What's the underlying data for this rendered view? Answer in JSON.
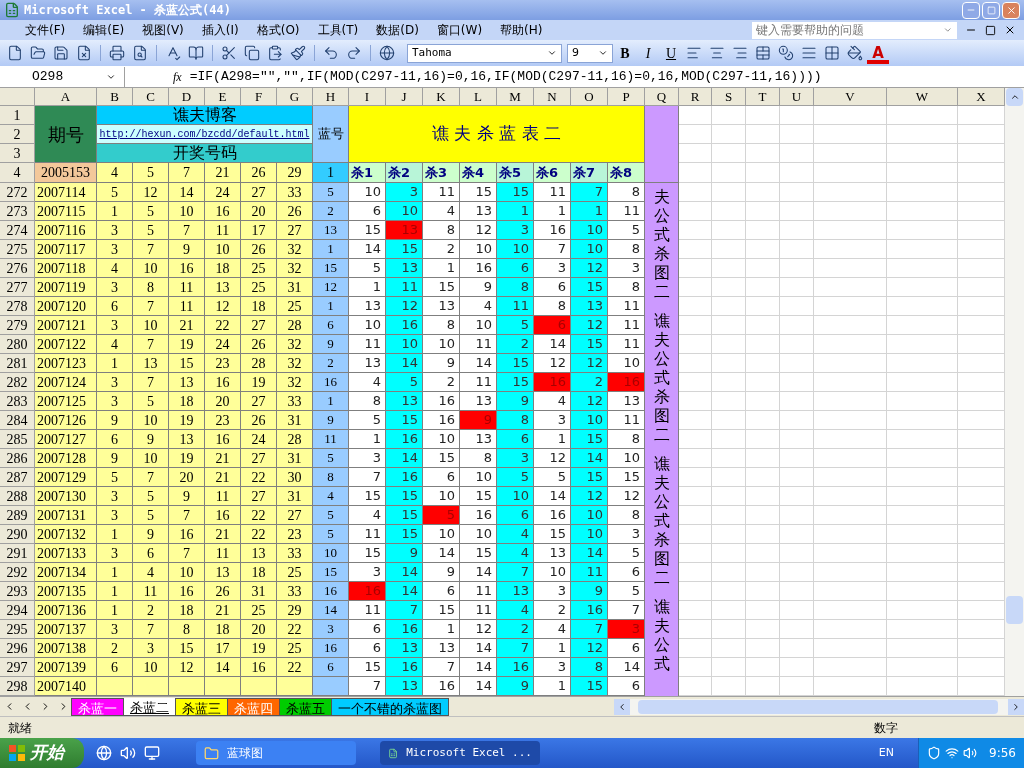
{
  "window": {
    "title": "Microsoft Excel - 杀蓝公式(44)"
  },
  "menu": [
    "文件(F)",
    "编辑(E)",
    "视图(V)",
    "插入(I)",
    "格式(O)",
    "工具(T)",
    "数据(D)",
    "窗口(W)",
    "帮助(H)"
  ],
  "help_box": {
    "placeholder": "键入需要帮助的问题"
  },
  "toolbar": {
    "font": "Tahoma",
    "size": "9",
    "format_buttons": [
      "B",
      "I",
      "U"
    ],
    "font_color_letter": "A"
  },
  "formula_bar": {
    "name_box": "O298",
    "fx": "fx",
    "formula": "=IF(A298=\"\",\"\",IF(MOD(C297-11,16)=0,16,IF(MOD(C297-11,16)=0,16,MOD(C297-11,16))))"
  },
  "columns": [
    "A",
    "B",
    "C",
    "D",
    "E",
    "F",
    "G",
    "H",
    "I",
    "J",
    "K",
    "L",
    "M",
    "N",
    "O",
    "P",
    "Q",
    "R",
    "S",
    "T",
    "U",
    "V",
    "W",
    "X"
  ],
  "header": {
    "row_numbers": [
      "1",
      "2",
      "3"
    ],
    "period_label": "期号",
    "blog_title": "谯夫博客",
    "link": "http://hexun.com/bzcdd/default.html",
    "draw_label": "开奖号码",
    "blue_label": "蓝号",
    "table_title": "谯 夫 杀 蓝 表 二",
    "side_texts": [
      "夫公式杀图二",
      "谯夫公式杀图二",
      "谯夫公式杀图二",
      "谯夫公式"
    ]
  },
  "first_row": {
    "row": "4",
    "period": "2005153",
    "numbers": [
      "4",
      "5",
      "7",
      "21",
      "26",
      "29"
    ],
    "blue": "1"
  },
  "kill_headers": [
    {
      "label": "杀1",
      "highlight": false
    },
    {
      "label": "杀2",
      "highlight": true
    },
    {
      "label": "杀3",
      "highlight": false
    },
    {
      "label": "杀4",
      "highlight": false
    },
    {
      "label": "杀5",
      "highlight": true
    },
    {
      "label": "杀6",
      "highlight": false
    },
    {
      "label": "杀7",
      "highlight": true
    },
    {
      "label": "杀8",
      "highlight": false
    }
  ],
  "rows": [
    {
      "row": "272",
      "period": "2007114",
      "numbers": [
        "5",
        "12",
        "14",
        "24",
        "27",
        "33"
      ],
      "blue": "5",
      "kills": [
        {
          "v": "10",
          "hit": false
        },
        {
          "v": "3",
          "hit": false
        },
        {
          "v": "11",
          "hit": false
        },
        {
          "v": "15",
          "hit": false
        },
        {
          "v": "15",
          "hit": false
        },
        {
          "v": "11",
          "hit": false
        },
        {
          "v": "7",
          "hit": false
        },
        {
          "v": "8",
          "hit": false
        }
      ]
    },
    {
      "row": "273",
      "period": "2007115",
      "numbers": [
        "1",
        "5",
        "10",
        "16",
        "20",
        "26"
      ],
      "blue": "2",
      "kills": [
        {
          "v": "6",
          "hit": false
        },
        {
          "v": "10",
          "hit": false
        },
        {
          "v": "4",
          "hit": false
        },
        {
          "v": "13",
          "hit": false
        },
        {
          "v": "1",
          "hit": false
        },
        {
          "v": "1",
          "hit": false
        },
        {
          "v": "1",
          "hit": false
        },
        {
          "v": "11",
          "hit": false
        }
      ]
    },
    {
      "row": "274",
      "period": "2007116",
      "numbers": [
        "3",
        "5",
        "7",
        "11",
        "17",
        "27"
      ],
      "blue": "13",
      "kills": [
        {
          "v": "15",
          "hit": false
        },
        {
          "v": "13",
          "hit": true
        },
        {
          "v": "8",
          "hit": false
        },
        {
          "v": "12",
          "hit": false
        },
        {
          "v": "3",
          "hit": false
        },
        {
          "v": "16",
          "hit": false
        },
        {
          "v": "10",
          "hit": false
        },
        {
          "v": "5",
          "hit": false
        }
      ]
    },
    {
      "row": "275",
      "period": "2007117",
      "numbers": [
        "3",
        "7",
        "9",
        "10",
        "26",
        "32"
      ],
      "blue": "1",
      "kills": [
        {
          "v": "14",
          "hit": false
        },
        {
          "v": "15",
          "hit": false
        },
        {
          "v": "2",
          "hit": false
        },
        {
          "v": "10",
          "hit": false
        },
        {
          "v": "10",
          "hit": false
        },
        {
          "v": "7",
          "hit": false
        },
        {
          "v": "10",
          "hit": false
        },
        {
          "v": "8",
          "hit": false
        }
      ]
    },
    {
      "row": "276",
      "period": "2007118",
      "numbers": [
        "4",
        "10",
        "16",
        "18",
        "25",
        "32"
      ],
      "blue": "15",
      "kills": [
        {
          "v": "5",
          "hit": false
        },
        {
          "v": "13",
          "hit": false
        },
        {
          "v": "1",
          "hit": false
        },
        {
          "v": "16",
          "hit": false
        },
        {
          "v": "6",
          "hit": false
        },
        {
          "v": "3",
          "hit": false
        },
        {
          "v": "12",
          "hit": false
        },
        {
          "v": "3",
          "hit": false
        }
      ]
    },
    {
      "row": "277",
      "period": "2007119",
      "numbers": [
        "3",
        "8",
        "11",
        "13",
        "25",
        "31"
      ],
      "blue": "12",
      "kills": [
        {
          "v": "1",
          "hit": false
        },
        {
          "v": "11",
          "hit": false
        },
        {
          "v": "15",
          "hit": false
        },
        {
          "v": "9",
          "hit": false
        },
        {
          "v": "8",
          "hit": false
        },
        {
          "v": "6",
          "hit": false
        },
        {
          "v": "15",
          "hit": false
        },
        {
          "v": "8",
          "hit": false
        }
      ]
    },
    {
      "row": "278",
      "period": "2007120",
      "numbers": [
        "6",
        "7",
        "11",
        "12",
        "18",
        "25"
      ],
      "blue": "1",
      "kills": [
        {
          "v": "13",
          "hit": false
        },
        {
          "v": "12",
          "hit": false
        },
        {
          "v": "13",
          "hit": false
        },
        {
          "v": "4",
          "hit": false
        },
        {
          "v": "11",
          "hit": false
        },
        {
          "v": "8",
          "hit": false
        },
        {
          "v": "13",
          "hit": false
        },
        {
          "v": "11",
          "hit": false
        }
      ]
    },
    {
      "row": "279",
      "period": "2007121",
      "numbers": [
        "3",
        "10",
        "21",
        "22",
        "27",
        "28"
      ],
      "blue": "6",
      "kills": [
        {
          "v": "10",
          "hit": false
        },
        {
          "v": "16",
          "hit": false
        },
        {
          "v": "8",
          "hit": false
        },
        {
          "v": "10",
          "hit": false
        },
        {
          "v": "5",
          "hit": false
        },
        {
          "v": "6",
          "hit": true
        },
        {
          "v": "12",
          "hit": false
        },
        {
          "v": "11",
          "hit": false
        }
      ]
    },
    {
      "row": "280",
      "period": "2007122",
      "numbers": [
        "4",
        "7",
        "19",
        "24",
        "26",
        "32"
      ],
      "blue": "9",
      "kills": [
        {
          "v": "11",
          "hit": false
        },
        {
          "v": "10",
          "hit": false
        },
        {
          "v": "10",
          "hit": false
        },
        {
          "v": "11",
          "hit": false
        },
        {
          "v": "2",
          "hit": false
        },
        {
          "v": "14",
          "hit": false
        },
        {
          "v": "15",
          "hit": false
        },
        {
          "v": "11",
          "hit": false
        }
      ]
    },
    {
      "row": "281",
      "period": "2007123",
      "numbers": [
        "1",
        "13",
        "15",
        "23",
        "28",
        "32"
      ],
      "blue": "2",
      "kills": [
        {
          "v": "13",
          "hit": false
        },
        {
          "v": "14",
          "hit": false
        },
        {
          "v": "9",
          "hit": false
        },
        {
          "v": "14",
          "hit": false
        },
        {
          "v": "15",
          "hit": false
        },
        {
          "v": "12",
          "hit": false
        },
        {
          "v": "12",
          "hit": false
        },
        {
          "v": "10",
          "hit": false
        }
      ]
    },
    {
      "row": "282",
      "period": "2007124",
      "numbers": [
        "3",
        "7",
        "13",
        "16",
        "19",
        "32"
      ],
      "blue": "16",
      "kills": [
        {
          "v": "4",
          "hit": false
        },
        {
          "v": "5",
          "hit": false
        },
        {
          "v": "2",
          "hit": false
        },
        {
          "v": "11",
          "hit": false
        },
        {
          "v": "15",
          "hit": false
        },
        {
          "v": "16",
          "hit": true
        },
        {
          "v": "2",
          "hit": false
        },
        {
          "v": "16",
          "hit": true
        }
      ]
    },
    {
      "row": "283",
      "period": "2007125",
      "numbers": [
        "3",
        "5",
        "18",
        "20",
        "27",
        "33"
      ],
      "blue": "1",
      "kills": [
        {
          "v": "8",
          "hit": false
        },
        {
          "v": "13",
          "hit": false
        },
        {
          "v": "16",
          "hit": false
        },
        {
          "v": "13",
          "hit": false
        },
        {
          "v": "9",
          "hit": false
        },
        {
          "v": "4",
          "hit": false
        },
        {
          "v": "12",
          "hit": false
        },
        {
          "v": "13",
          "hit": false
        }
      ]
    },
    {
      "row": "284",
      "period": "2007126",
      "numbers": [
        "9",
        "10",
        "19",
        "23",
        "26",
        "31"
      ],
      "blue": "9",
      "kills": [
        {
          "v": "5",
          "hit": false
        },
        {
          "v": "15",
          "hit": false
        },
        {
          "v": "16",
          "hit": false
        },
        {
          "v": "9",
          "hit": true
        },
        {
          "v": "8",
          "hit": false
        },
        {
          "v": "3",
          "hit": false
        },
        {
          "v": "10",
          "hit": false
        },
        {
          "v": "11",
          "hit": false
        }
      ]
    },
    {
      "row": "285",
      "period": "2007127",
      "numbers": [
        "6",
        "9",
        "13",
        "16",
        "24",
        "28"
      ],
      "blue": "11",
      "kills": [
        {
          "v": "1",
          "hit": false
        },
        {
          "v": "16",
          "hit": false
        },
        {
          "v": "10",
          "hit": false
        },
        {
          "v": "13",
          "hit": false
        },
        {
          "v": "6",
          "hit": false
        },
        {
          "v": "1",
          "hit": false
        },
        {
          "v": "15",
          "hit": false
        },
        {
          "v": "8",
          "hit": false
        }
      ]
    },
    {
      "row": "286",
      "period": "2007128",
      "numbers": [
        "9",
        "10",
        "19",
        "21",
        "27",
        "31"
      ],
      "blue": "5",
      "kills": [
        {
          "v": "3",
          "hit": false
        },
        {
          "v": "14",
          "hit": false
        },
        {
          "v": "15",
          "hit": false
        },
        {
          "v": "8",
          "hit": false
        },
        {
          "v": "3",
          "hit": false
        },
        {
          "v": "12",
          "hit": false
        },
        {
          "v": "14",
          "hit": false
        },
        {
          "v": "10",
          "hit": false
        }
      ]
    },
    {
      "row": "287",
      "period": "2007129",
      "numbers": [
        "5",
        "7",
        "20",
        "21",
        "22",
        "30"
      ],
      "blue": "8",
      "kills": [
        {
          "v": "7",
          "hit": false
        },
        {
          "v": "16",
          "hit": false
        },
        {
          "v": "6",
          "hit": false
        },
        {
          "v": "10",
          "hit": false
        },
        {
          "v": "5",
          "hit": false
        },
        {
          "v": "5",
          "hit": false
        },
        {
          "v": "15",
          "hit": false
        },
        {
          "v": "15",
          "hit": false
        }
      ]
    },
    {
      "row": "288",
      "period": "2007130",
      "numbers": [
        "3",
        "5",
        "9",
        "11",
        "27",
        "31"
      ],
      "blue": "4",
      "kills": [
        {
          "v": "15",
          "hit": false
        },
        {
          "v": "15",
          "hit": false
        },
        {
          "v": "10",
          "hit": false
        },
        {
          "v": "15",
          "hit": false
        },
        {
          "v": "10",
          "hit": false
        },
        {
          "v": "14",
          "hit": false
        },
        {
          "v": "12",
          "hit": false
        },
        {
          "v": "12",
          "hit": false
        }
      ]
    },
    {
      "row": "289",
      "period": "2007131",
      "numbers": [
        "3",
        "5",
        "7",
        "16",
        "22",
        "27"
      ],
      "blue": "5",
      "kills": [
        {
          "v": "4",
          "hit": false
        },
        {
          "v": "15",
          "hit": false
        },
        {
          "v": "5",
          "hit": true
        },
        {
          "v": "16",
          "hit": false
        },
        {
          "v": "6",
          "hit": false
        },
        {
          "v": "16",
          "hit": false
        },
        {
          "v": "10",
          "hit": false
        },
        {
          "v": "8",
          "hit": false
        }
      ]
    },
    {
      "row": "290",
      "period": "2007132",
      "numbers": [
        "1",
        "9",
        "16",
        "21",
        "22",
        "23"
      ],
      "blue": "5",
      "kills": [
        {
          "v": "11",
          "hit": false
        },
        {
          "v": "15",
          "hit": false
        },
        {
          "v": "10",
          "hit": false
        },
        {
          "v": "10",
          "hit": false
        },
        {
          "v": "4",
          "hit": false
        },
        {
          "v": "15",
          "hit": false
        },
        {
          "v": "10",
          "hit": false
        },
        {
          "v": "3",
          "hit": false
        }
      ]
    },
    {
      "row": "291",
      "period": "2007133",
      "numbers": [
        "3",
        "6",
        "7",
        "11",
        "13",
        "33"
      ],
      "blue": "10",
      "kills": [
        {
          "v": "15",
          "hit": false
        },
        {
          "v": "9",
          "hit": false
        },
        {
          "v": "14",
          "hit": false
        },
        {
          "v": "15",
          "hit": false
        },
        {
          "v": "4",
          "hit": false
        },
        {
          "v": "13",
          "hit": false
        },
        {
          "v": "14",
          "hit": false
        },
        {
          "v": "5",
          "hit": false
        }
      ]
    },
    {
      "row": "292",
      "period": "2007134",
      "numbers": [
        "1",
        "4",
        "10",
        "13",
        "18",
        "25"
      ],
      "blue": "15",
      "kills": [
        {
          "v": "3",
          "hit": false
        },
        {
          "v": "14",
          "hit": false
        },
        {
          "v": "9",
          "hit": false
        },
        {
          "v": "14",
          "hit": false
        },
        {
          "v": "7",
          "hit": false
        },
        {
          "v": "10",
          "hit": false
        },
        {
          "v": "11",
          "hit": false
        },
        {
          "v": "6",
          "hit": false
        }
      ]
    },
    {
      "row": "293",
      "period": "2007135",
      "numbers": [
        "1",
        "11",
        "16",
        "26",
        "31",
        "33"
      ],
      "blue": "16",
      "kills": [
        {
          "v": "16",
          "hit": true
        },
        {
          "v": "14",
          "hit": false
        },
        {
          "v": "6",
          "hit": false
        },
        {
          "v": "11",
          "hit": false
        },
        {
          "v": "13",
          "hit": false
        },
        {
          "v": "3",
          "hit": false
        },
        {
          "v": "9",
          "hit": false
        },
        {
          "v": "5",
          "hit": false
        }
      ]
    },
    {
      "row": "294",
      "period": "2007136",
      "numbers": [
        "1",
        "2",
        "18",
        "21",
        "25",
        "29"
      ],
      "blue": "14",
      "kills": [
        {
          "v": "11",
          "hit": false
        },
        {
          "v": "7",
          "hit": false
        },
        {
          "v": "15",
          "hit": false
        },
        {
          "v": "11",
          "hit": false
        },
        {
          "v": "4",
          "hit": false
        },
        {
          "v": "2",
          "hit": false
        },
        {
          "v": "16",
          "hit": false
        },
        {
          "v": "7",
          "hit": false
        }
      ]
    },
    {
      "row": "295",
      "period": "2007137",
      "numbers": [
        "3",
        "7",
        "8",
        "18",
        "20",
        "22"
      ],
      "blue": "3",
      "kills": [
        {
          "v": "6",
          "hit": false
        },
        {
          "v": "16",
          "hit": false
        },
        {
          "v": "1",
          "hit": false
        },
        {
          "v": "12",
          "hit": false
        },
        {
          "v": "2",
          "hit": false
        },
        {
          "v": "4",
          "hit": false
        },
        {
          "v": "7",
          "hit": false
        },
        {
          "v": "3",
          "hit": true
        }
      ]
    },
    {
      "row": "296",
      "period": "2007138",
      "numbers": [
        "2",
        "3",
        "15",
        "17",
        "19",
        "25"
      ],
      "blue": "16",
      "kills": [
        {
          "v": "6",
          "hit": false
        },
        {
          "v": "13",
          "hit": false
        },
        {
          "v": "13",
          "hit": false
        },
        {
          "v": "14",
          "hit": false
        },
        {
          "v": "7",
          "hit": false
        },
        {
          "v": "1",
          "hit": false
        },
        {
          "v": "12",
          "hit": false
        },
        {
          "v": "6",
          "hit": false
        }
      ]
    },
    {
      "row": "297",
      "period": "2007139",
      "numbers": [
        "6",
        "10",
        "12",
        "14",
        "16",
        "22"
      ],
      "blue": "6",
      "kills": [
        {
          "v": "15",
          "hit": false
        },
        {
          "v": "16",
          "hit": false
        },
        {
          "v": "7",
          "hit": false
        },
        {
          "v": "14",
          "hit": false
        },
        {
          "v": "16",
          "hit": false
        },
        {
          "v": "3",
          "hit": false
        },
        {
          "v": "8",
          "hit": false
        },
        {
          "v": "14",
          "hit": false
        }
      ]
    },
    {
      "row": "298",
      "period": "2007140",
      "kills": [
        {
          "v": "7",
          "hit": false
        },
        {
          "v": "13",
          "hit": false
        },
        {
          "v": "16",
          "hit": false
        },
        {
          "v": "14",
          "hit": false
        },
        {
          "v": "9",
          "hit": false
        },
        {
          "v": "1",
          "hit": false
        },
        {
          "v": "15",
          "hit": false
        },
        {
          "v": "6",
          "hit": false
        }
      ]
    }
  ],
  "sheet_tabs": [
    {
      "label": "杀蓝一",
      "color": "#ff00ff",
      "selected": false
    },
    {
      "label": "杀蓝二",
      "color": "#ffffff",
      "selected": true
    },
    {
      "label": "杀蓝三",
      "color": "#ffff00",
      "selected": false
    },
    {
      "label": "杀蓝四",
      "color": "#ff6600",
      "selected": false
    },
    {
      "label": "杀蓝五",
      "color": "#00cc00",
      "selected": false
    },
    {
      "label": "一个不错的杀蓝图",
      "color": "#00ccff",
      "selected": false
    }
  ],
  "status": {
    "left": "就绪",
    "mode": "数字"
  },
  "taskbar": {
    "start": "开始",
    "items": [
      {
        "label": "蓝球图",
        "kind": "folder",
        "selected": false
      },
      {
        "label": "Microsoft Excel ...",
        "kind": "excel",
        "selected": true
      }
    ],
    "lang": "EN",
    "clock": "9:56"
  }
}
